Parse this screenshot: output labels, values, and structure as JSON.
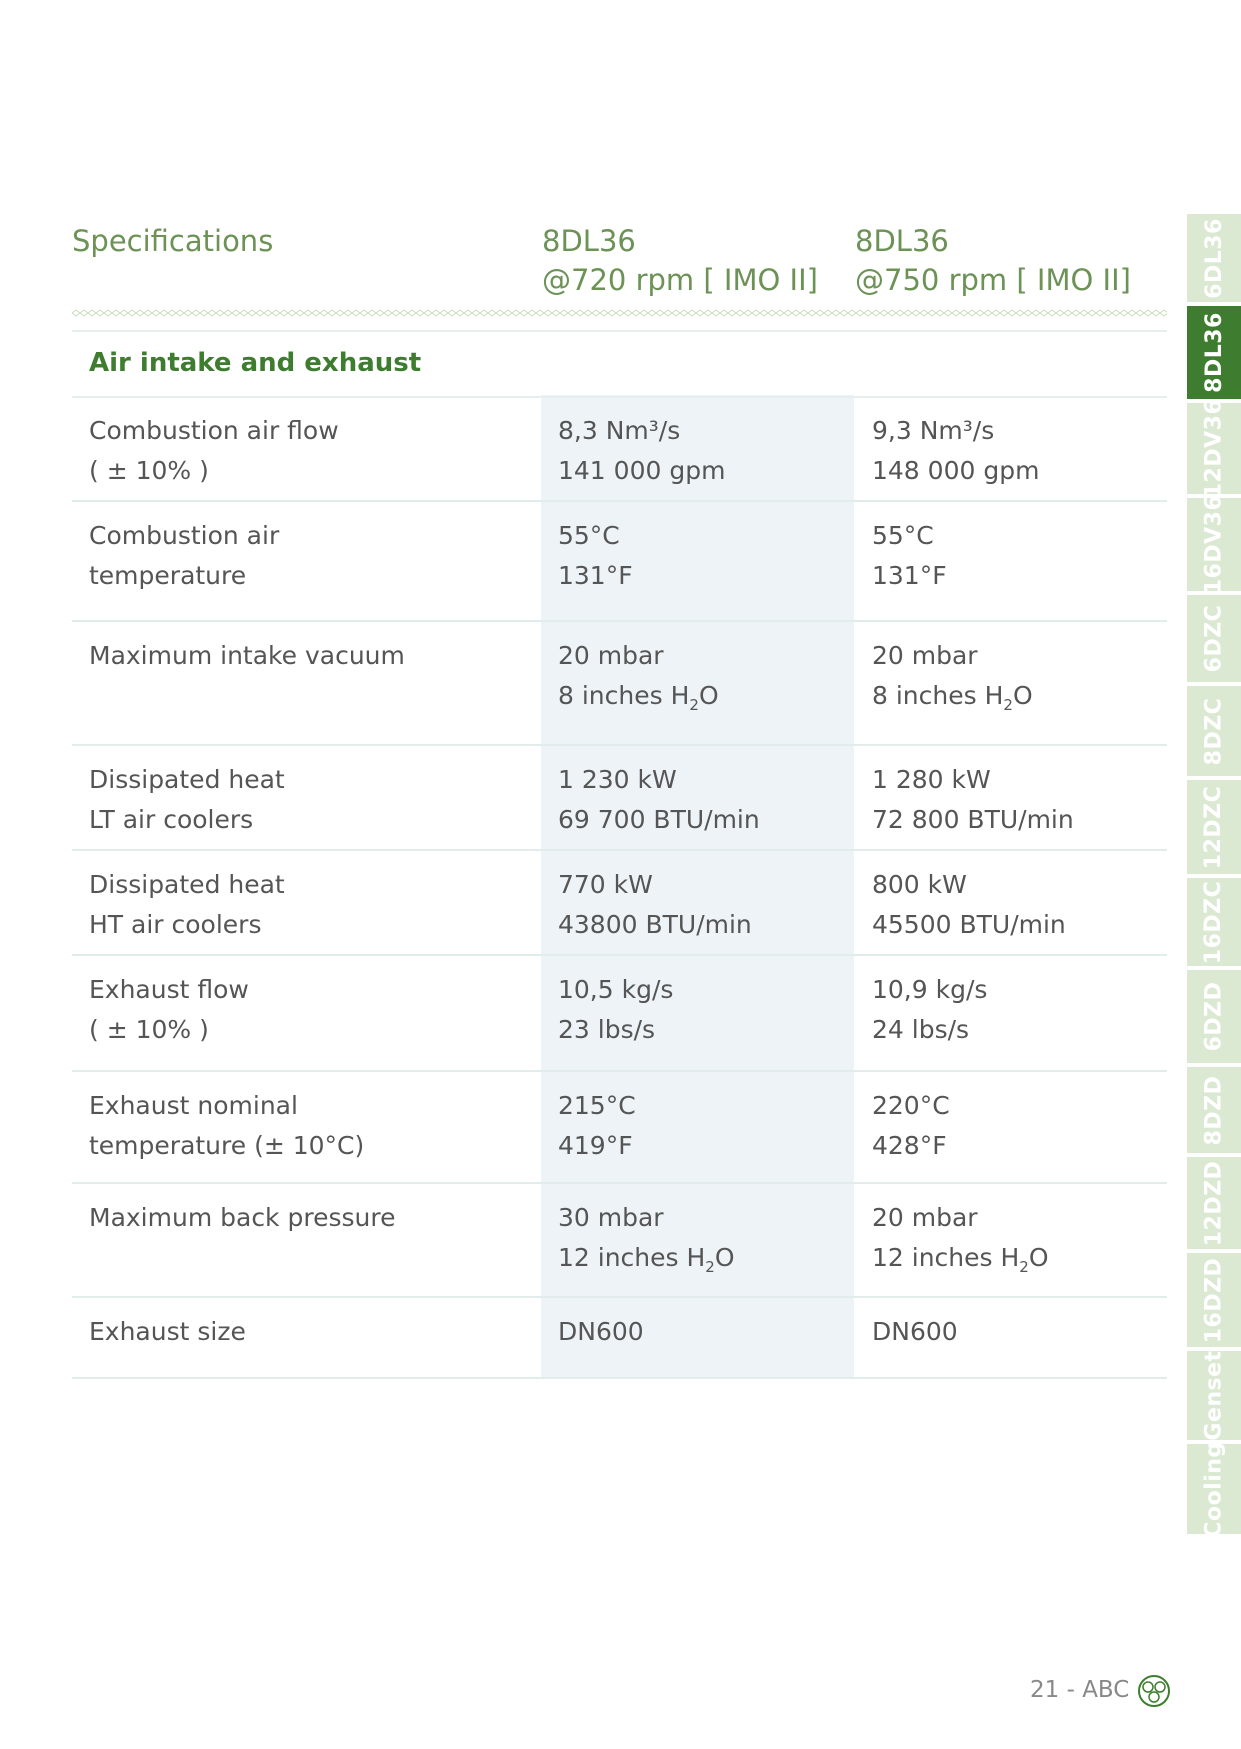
{
  "header": {
    "col0": "Specifications",
    "col1_line1": "8DL36",
    "col1_line2": "@720 rpm [ IMO II]",
    "col2_line1": "8DL36",
    "col2_line2": "@750 rpm [ IMO II]"
  },
  "section": {
    "title": "Air intake and exhaust"
  },
  "rows": [
    {
      "label": [
        "Combustion air flow",
        "( ± 10% )"
      ],
      "v720": [
        "8,3 Nm³/s",
        "141 000 gpm"
      ],
      "v750": [
        "9,3 Nm³/s",
        "148 000 gpm"
      ]
    },
    {
      "label": [
        "Combustion air",
        "temperature"
      ],
      "v720": [
        "55°C",
        "131°F"
      ],
      "v750": [
        "55°C",
        "131°F"
      ]
    },
    {
      "label": [
        "Maximum intake vacuum",
        ""
      ],
      "v720": [
        "20 mbar",
        "8 inches H",
        "2",
        "O"
      ],
      "v750": [
        "20 mbar",
        "8 inches H",
        "2",
        "O"
      ]
    },
    {
      "label": [
        "Dissipated heat",
        "LT air coolers"
      ],
      "v720": [
        "1 230 kW",
        "69 700 BTU/min"
      ],
      "v750": [
        "1 280 kW",
        "72 800 BTU/min"
      ]
    },
    {
      "label": [
        "Dissipated heat",
        "HT air coolers"
      ],
      "v720": [
        "770 kW",
        "43800 BTU/min"
      ],
      "v750": [
        "800 kW",
        "45500 BTU/min"
      ]
    },
    {
      "label": [
        "Exhaust flow",
        "( ± 10% )"
      ],
      "v720": [
        "10,5 kg/s",
        "23 lbs/s"
      ],
      "v750": [
        "10,9 kg/s",
        "24 lbs/s"
      ]
    },
    {
      "label": [
        "Exhaust nominal",
        "temperature (± 10°C)"
      ],
      "v720": [
        "215°C",
        "419°F"
      ],
      "v750": [
        "220°C",
        "428°F"
      ]
    },
    {
      "label": [
        "Maximum back pressure",
        ""
      ],
      "v720": [
        "30 mbar",
        "12 inches H",
        "2",
        "O"
      ],
      "v750": [
        "20 mbar",
        "12 inches H",
        "2",
        "O"
      ]
    },
    {
      "label": [
        "Exhaust size",
        ""
      ],
      "v720": [
        "DN600",
        ""
      ],
      "v750": [
        "DN600",
        ""
      ]
    }
  ],
  "tabs": [
    "6DL36",
    "8DL36",
    "12DV36",
    "16DV36",
    "6DZC",
    "8DZC",
    "12DZC",
    "16DZC",
    "6DZD",
    "8DZD",
    "12DZD",
    "16DZD",
    "Genset",
    "Cooling"
  ],
  "active_tab": "8DL36",
  "footer": {
    "page": "21 - ABC"
  },
  "colors": {
    "accent": "#3e7d2f",
    "header_green": "#6c9256",
    "tab_light": "#dbe9d3",
    "band": "#edf3f6"
  }
}
